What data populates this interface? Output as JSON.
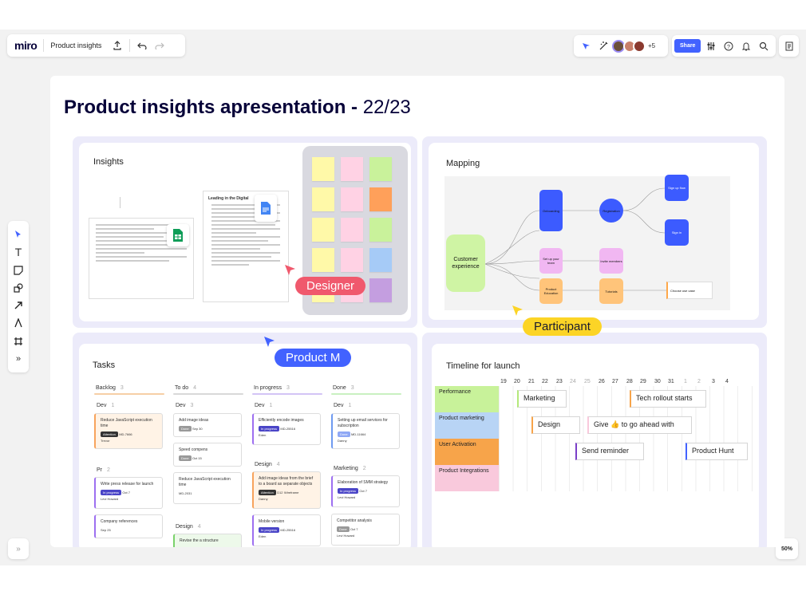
{
  "app": {
    "logo": "miro",
    "board_name": "Product insights"
  },
  "topbar": {
    "share_label": "Share",
    "collaborators_extra": "+5"
  },
  "zoom": "50%",
  "board": {
    "title_bold": "Product insights apresentation - ",
    "title_rest": "22/23"
  },
  "frames": {
    "insights": {
      "title": "Insights",
      "doc_title": "Leading in the Digital"
    },
    "mapping": {
      "title": "Mapping",
      "nodes": {
        "customer_experience": "Customer experience",
        "onboarding": "Onboarding",
        "registration": "Registration",
        "sign_up_flow": "Sign up flow",
        "sign_in": "Sign in",
        "set_up_your_team": "Set up your team",
        "invite_members": "Invite members",
        "product_education": "Product Education",
        "tutorials": "Tutorials",
        "choose_use_case": "Choose use case"
      }
    },
    "tasks": {
      "title": "Tasks",
      "columns": [
        {
          "name": "Backlog",
          "count": "3"
        },
        {
          "name": "To do",
          "count": "4"
        },
        {
          "name": "In progress",
          "count": "3"
        },
        {
          "name": "Done",
          "count": "3"
        }
      ],
      "subgroups": {
        "backlog_dev": {
          "name": "Dev",
          "count": "1"
        },
        "backlog_pr": {
          "name": "Pr",
          "count": "2"
        },
        "todo_dev": {
          "name": "Dev",
          "count": "3"
        },
        "todo_design": {
          "name": "Design",
          "count": "4"
        },
        "inprog_dev": {
          "name": "Dev",
          "count": "1"
        },
        "inprog_design": {
          "name": "Design",
          "count": "4"
        },
        "done_dev": {
          "name": "Dev",
          "count": "1"
        },
        "done_marketing": {
          "name": "Marketing",
          "count": "2"
        }
      },
      "cards": {
        "c1": {
          "title": "Reduce JavaScript execution time",
          "tag": "Attention",
          "id": "MD-7666",
          "who": "Trevor"
        },
        "c2": {
          "title": "Write press release for launch",
          "tag": "In progress",
          "date": "Oct 7",
          "who": "Levi Howard"
        },
        "c3": {
          "title": "Company references",
          "date": "Sep 25"
        },
        "c4": {
          "title": "Add image ideas",
          "tag": "Done",
          "date": "Sep 30"
        },
        "c5": {
          "title": "Speed compens",
          "tag": "Done",
          "date": "Oct 15"
        },
        "c6": {
          "title": "Reduce JavaScript execution time",
          "id": "MD-2031"
        },
        "c7": {
          "title": "Revise the a structure"
        },
        "c8": {
          "title": "Efficiently encode images",
          "tag": "In progress",
          "id": "MD-25516",
          "who": "Eden"
        },
        "c9": {
          "title": "Add image ideas from the brief to a board as separate objects",
          "tag": "Attention",
          "id": "D12",
          "extra": "Wireframe",
          "who": "Danny"
        },
        "c10": {
          "title": "Mobile version",
          "tag": "In progress",
          "id": "MD-25516",
          "who": "Eden"
        },
        "c11": {
          "title": "Setting up email services for subscription",
          "tag": "Done",
          "id": "MD-11664",
          "who": "Danny"
        },
        "c12": {
          "title": "Elaboration of SMM strategy",
          "tag": "In progress",
          "date": "Oct 7",
          "who": "Levi Howard"
        },
        "c13": {
          "title": "Competitor analysis",
          "tag": "Done",
          "date": "Oct 7",
          "who": "Levi Howard"
        }
      }
    },
    "timeline": {
      "title": "Timeline for launch",
      "days": [
        "19",
        "20",
        "21",
        "22",
        "23",
        "24",
        "25",
        "26",
        "27",
        "28",
        "29",
        "30",
        "31",
        "1",
        "2",
        "3",
        "4"
      ],
      "rows": [
        "Performance",
        "Product marketing",
        "User Activation",
        "Product Integrations"
      ],
      "bars": {
        "marketing": "Marketing",
        "tech_rollout": "Tech rollout starts",
        "design": "Design",
        "give_go_ahead": "Give 👍 to go ahead with",
        "send_reminder": "Send reminder",
        "product_hunt": "Product Hunt"
      },
      "row_colors": [
        "#c8f29a",
        "#b8d4f5",
        "#f7a44a",
        "#f9c9dc"
      ]
    }
  },
  "cursors": {
    "designer": "Designer",
    "participant": "Participant",
    "product_m": "Product M"
  },
  "colors": {
    "designer": "#f0596d",
    "participant": "#fcd426",
    "product_m": "#4262ff",
    "share": "#4262ff",
    "brand": "#050038"
  }
}
